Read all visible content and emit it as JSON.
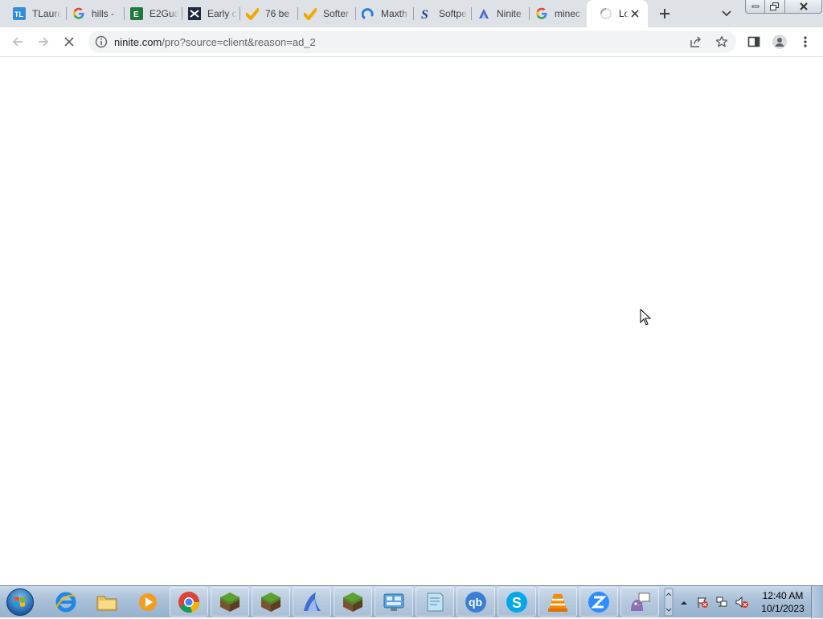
{
  "browser": {
    "tabs": [
      {
        "title": "TLaurel",
        "icon": "tl-logo-icon"
      },
      {
        "title": "hills -",
        "icon": "google-icon"
      },
      {
        "title": "E2Gua",
        "icon": "e2guardian-icon"
      },
      {
        "title": "Early c",
        "icon": "bookmark-x-icon"
      },
      {
        "title": "76 be",
        "icon": "softonic-check-icon"
      },
      {
        "title": "Softer",
        "icon": "softonic-check-icon"
      },
      {
        "title": "Maxth",
        "icon": "maxthon-icon"
      },
      {
        "title": "Softpe",
        "icon": "softpedia-icon"
      },
      {
        "title": "Ninite",
        "icon": "ninite-icon"
      },
      {
        "title": "minec",
        "icon": "google-icon"
      },
      {
        "title": "Lo",
        "icon": "loading-spinner-icon",
        "active": true
      }
    ],
    "address_bar": {
      "domain": "ninite.com",
      "path": "/pro?source=client&reason=ad_2"
    }
  },
  "taskbar": {
    "apps": [
      "internet-explorer-icon",
      "file-explorer-icon",
      "media-player-icon",
      "chrome-icon",
      "minecraft-block-icon",
      "minecraft-block-icon",
      "maxthon-browser-icon",
      "minecraft-block-icon",
      "control-panel-icon",
      "notepad-icon",
      "qbittorrent-icon",
      "skype-icon",
      "vlc-icon",
      "zoom-icon",
      "pidgin-icon"
    ],
    "clock": {
      "time": "12:40 AM",
      "date": "10/1/2023"
    }
  },
  "colors": {
    "tabstrip": "#dee1e6",
    "omnibox": "#f1f3f4",
    "taskbar": "#a9c0d8"
  }
}
